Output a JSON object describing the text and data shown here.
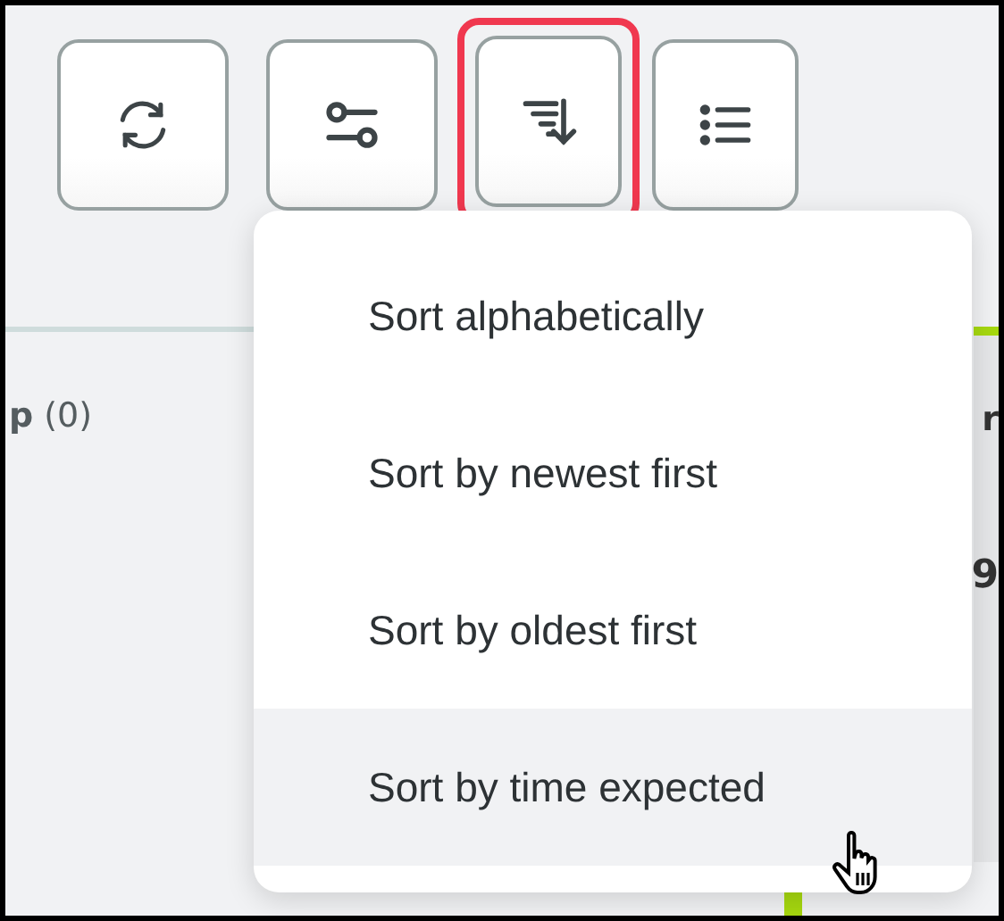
{
  "toolbar": [
    {
      "kind": "refresh",
      "selected": false
    },
    {
      "kind": "filter",
      "selected": false
    },
    {
      "kind": "sort",
      "selected": true
    },
    {
      "kind": "list",
      "selected": false
    }
  ],
  "background": {
    "left_heading": "**p** (0)",
    "right_heading": "r",
    "right_value": "9"
  },
  "sort_menu": [
    {
      "label": "Sort alphabetically",
      "hovered": false
    },
    {
      "label": "Sort by newest first",
      "hovered": false
    },
    {
      "label": "Sort by oldest first",
      "hovered": false
    },
    {
      "label": "Sort by time expected",
      "hovered": true
    }
  ]
}
